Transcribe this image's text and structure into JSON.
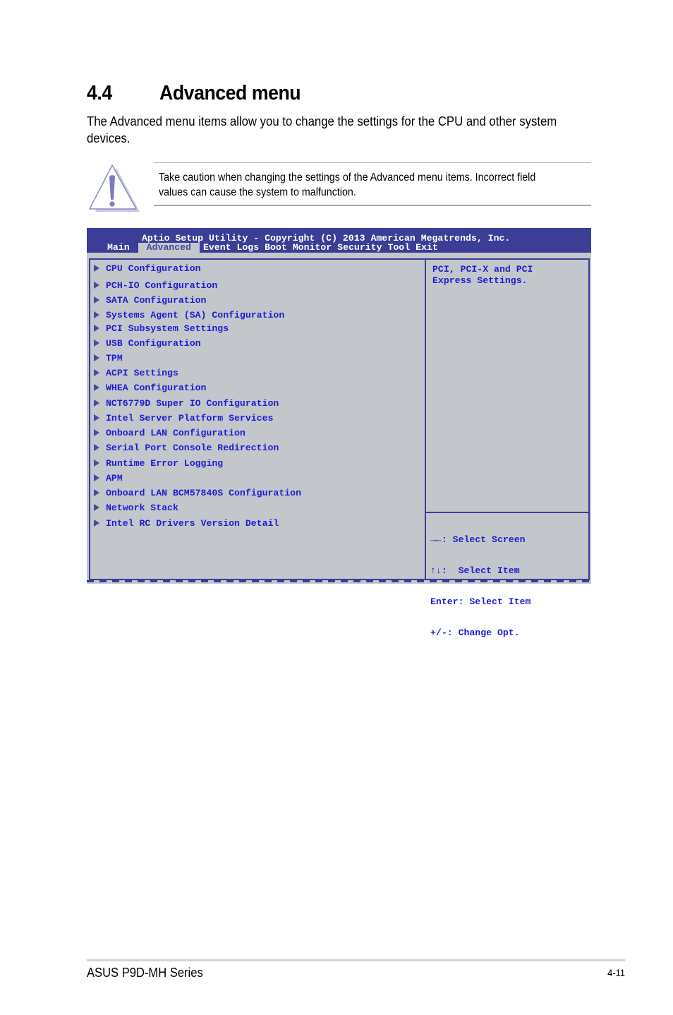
{
  "section": {
    "number": "4.4",
    "title": "Advanced menu",
    "intro": "The Advanced menu items allow you to change the settings for the CPU and other system devices."
  },
  "caution": {
    "icon": "warning-triangle-icon",
    "text": "Take caution when changing the settings of the Advanced menu items. Incorrect field values can cause the system to malfunction."
  },
  "bios": {
    "title": "Aptio Setup Utility - Copyright (C) 2013 American Megatrends, Inc.",
    "tabs": [
      {
        "label": "Main",
        "active": false
      },
      {
        "label": "Advanced",
        "active": true
      },
      {
        "label": "Event Logs",
        "active": false
      },
      {
        "label": "Boot",
        "active": false
      },
      {
        "label": "Monitor",
        "active": false
      },
      {
        "label": "Security",
        "active": false
      },
      {
        "label": "Tool",
        "active": false
      },
      {
        "label": "Exit",
        "active": false
      }
    ],
    "menu_items": [
      "CPU Configuration",
      "PCH-IO Configuration",
      "SATA Configuration",
      "Systems Agent (SA) Configuration",
      "PCI Subsystem Settings",
      "USB Configuration",
      "TPM",
      "ACPI Settings",
      "WHEA Configuration",
      "NCT6779D Super IO Configuration",
      "Intel Server Platform Services",
      "Onboard LAN Configuration",
      "Serial Port Console Redirection",
      "Runtime Error Logging",
      "APM",
      "Onboard LAN BCM57840S Configuration",
      "Network Stack",
      "Intel RC Drivers Version Detail"
    ],
    "help_text": "PCI, PCI-X and PCI\nExpress Settings.",
    "key_legend": [
      "→←: Select Screen",
      "↑↓:  Select Item",
      "Enter: Select Item",
      "+/-: Change Opt."
    ],
    "colors": {
      "header_bg": "#3b3d96",
      "panel_bg": "#c3c6cb",
      "item_text": "#1d1dd0",
      "active_tab_text": "#4848a0"
    }
  },
  "footer": {
    "product": "ASUS P9D-MH Series",
    "page": "4-11"
  }
}
